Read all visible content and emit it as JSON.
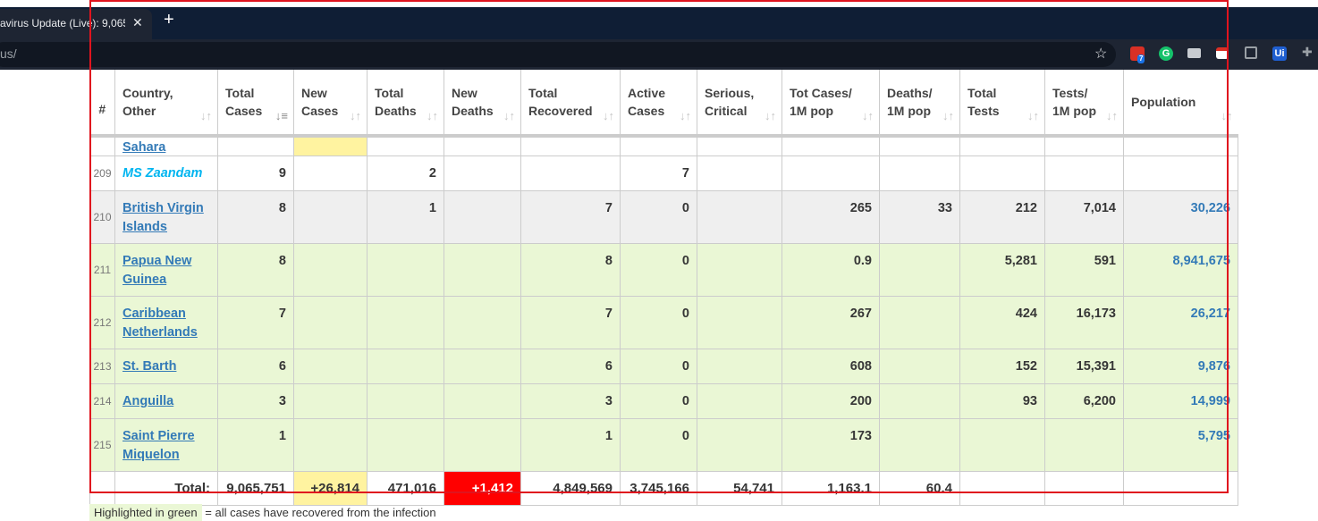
{
  "browser": {
    "tab_title": "avirus Update (Live): 9,065,",
    "tab_close": "✕",
    "new_tab": "+",
    "url": "us/",
    "ext_badge": "7",
    "ext_grammarly": "G",
    "ext_ui": "Ui"
  },
  "table": {
    "headers": [
      {
        "line1": "#",
        "line2": ""
      },
      {
        "line1": "Country,",
        "line2": "Other"
      },
      {
        "line1": "Total",
        "line2": "Cases"
      },
      {
        "line1": "New",
        "line2": "Cases"
      },
      {
        "line1": "Total",
        "line2": "Deaths"
      },
      {
        "line1": "New",
        "line2": "Deaths"
      },
      {
        "line1": "Total",
        "line2": "Recovered"
      },
      {
        "line1": "Active",
        "line2": "Cases"
      },
      {
        "line1": "Serious,",
        "line2": "Critical"
      },
      {
        "line1": "Tot Cases/",
        "line2": "1M pop"
      },
      {
        "line1": "Deaths/",
        "line2": "1M pop"
      },
      {
        "line1": "Total",
        "line2": "Tests"
      },
      {
        "line1": "Tests/",
        "line2": "1M pop"
      },
      {
        "line1": "Population",
        "line2": ""
      }
    ],
    "partial_country": "Sahara",
    "rows": [
      {
        "rank": "209",
        "country": "MS Zaandam",
        "total_cases": "9",
        "new_cases": "",
        "total_deaths": "2",
        "new_deaths": "",
        "total_recovered": "",
        "active_cases": "7",
        "serious": "",
        "cases_per_m": "",
        "deaths_per_m": "",
        "total_tests": "",
        "tests_per_m": "",
        "population": ""
      },
      {
        "rank": "210",
        "country": "British Virgin Islands",
        "total_cases": "8",
        "new_cases": "",
        "total_deaths": "1",
        "new_deaths": "",
        "total_recovered": "7",
        "active_cases": "0",
        "serious": "",
        "cases_per_m": "265",
        "deaths_per_m": "33",
        "total_tests": "212",
        "tests_per_m": "7,014",
        "population": "30,226"
      },
      {
        "rank": "211",
        "country": "Papua New Guinea",
        "total_cases": "8",
        "new_cases": "",
        "total_deaths": "",
        "new_deaths": "",
        "total_recovered": "8",
        "active_cases": "0",
        "serious": "",
        "cases_per_m": "0.9",
        "deaths_per_m": "",
        "total_tests": "5,281",
        "tests_per_m": "591",
        "population": "8,941,675"
      },
      {
        "rank": "212",
        "country": "Caribbean Netherlands",
        "total_cases": "7",
        "new_cases": "",
        "total_deaths": "",
        "new_deaths": "",
        "total_recovered": "7",
        "active_cases": "0",
        "serious": "",
        "cases_per_m": "267",
        "deaths_per_m": "",
        "total_tests": "424",
        "tests_per_m": "16,173",
        "population": "26,217"
      },
      {
        "rank": "213",
        "country": "St. Barth",
        "total_cases": "6",
        "new_cases": "",
        "total_deaths": "",
        "new_deaths": "",
        "total_recovered": "6",
        "active_cases": "0",
        "serious": "",
        "cases_per_m": "608",
        "deaths_per_m": "",
        "total_tests": "152",
        "tests_per_m": "15,391",
        "population": "9,876"
      },
      {
        "rank": "214",
        "country": "Anguilla",
        "total_cases": "3",
        "new_cases": "",
        "total_deaths": "",
        "new_deaths": "",
        "total_recovered": "3",
        "active_cases": "0",
        "serious": "",
        "cases_per_m": "200",
        "deaths_per_m": "",
        "total_tests": "93",
        "tests_per_m": "6,200",
        "population": "14,999"
      },
      {
        "rank": "215",
        "country": "Saint Pierre Miquelon",
        "total_cases": "1",
        "new_cases": "",
        "total_deaths": "",
        "new_deaths": "",
        "total_recovered": "1",
        "active_cases": "0",
        "serious": "",
        "cases_per_m": "173",
        "deaths_per_m": "",
        "total_tests": "",
        "tests_per_m": "",
        "population": "5,795"
      }
    ],
    "total": {
      "label": "Total:",
      "total_cases": "9,065,751",
      "new_cases": "+26,814",
      "total_deaths": "471,016",
      "new_deaths": "+1,412",
      "total_recovered": "4,849,569",
      "active_cases": "3,745,166",
      "serious": "54,741",
      "cases_per_m": "1,163.1",
      "deaths_per_m": "60.4"
    }
  },
  "legend": {
    "swatch": "Highlighted in green",
    "text": "= all cases have recovered from the infection"
  }
}
